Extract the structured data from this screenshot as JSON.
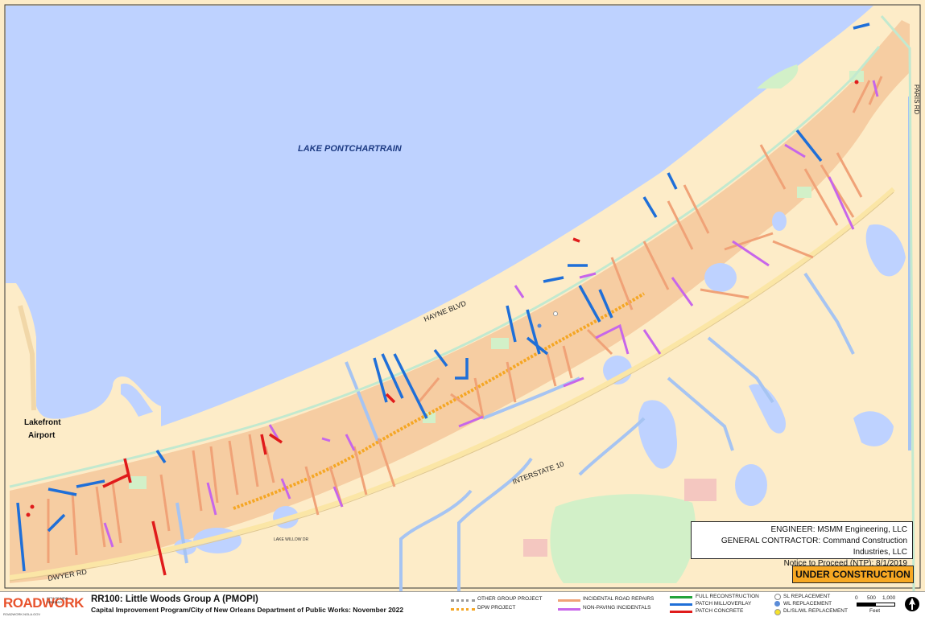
{
  "map": {
    "water_label": "LAKE PONTCHARTRAIN",
    "airport_label": "Lakefront\nAirport",
    "roads": {
      "hayne": "HAYNE BLVD",
      "interstate": "INTERSTATE 10",
      "dwyer": "DWYER RD",
      "paris": "PARIS RD",
      "lake_willow": "LAKE WILLOW DR"
    },
    "colors": {
      "lake": "#bed2ff",
      "land": "#fdecc8",
      "project_area": "#f5c89b",
      "park": "#d2f0c8",
      "canal": "#a6c4f2",
      "patch_mill": "#1f6fd8",
      "patch_concrete": "#e01b1b",
      "incidental": "#f0a277",
      "non_paving": "#c766ea",
      "dpw_project": "#f5a623"
    }
  },
  "project_info": {
    "engineer": "ENGINEER:  MSMM Engineering, LLC",
    "contractor": "GENERAL CONTRACTOR:  Command Construction Industries, LLC",
    "ntp": "Notice to Proceed (NTP):  8/1/2019"
  },
  "status": "UNDER CONSTRUCTION",
  "footer": {
    "logo_text": "ROADWORK",
    "logo_small": "CITY OF NEW ORLEANS",
    "logo_tag": "ROADWORK.NOLA.GOV",
    "title": "RR100:  Little Woods Group A (PMOPI)",
    "subtitle": "Capital Improvement Program/City of New Orleans Department of Public Works:  November 2022"
  },
  "legend": {
    "other_group": "OTHER GROUP PROJECT",
    "dpw_project": "DPW PROJECT",
    "incidental_road": "INCIDENTAL ROAD REPAIRS",
    "non_paving": "NON-PAVING INCIDENTALS",
    "full_recon": "FULL RECONSTRUCTION",
    "patch_mill": "PATCH MILL/OVERLAY",
    "patch_concrete": "PATCH CONCRETE",
    "sl_replacement": "SL REPLACEMENT",
    "wl_replacement": "WL REPLACEMENT",
    "dl_replacement": "DL/SL/WL REPLACEMENT",
    "scale_0": "0",
    "scale_500": "500",
    "scale_1000": "1,000",
    "scale_unit": "Feet"
  }
}
